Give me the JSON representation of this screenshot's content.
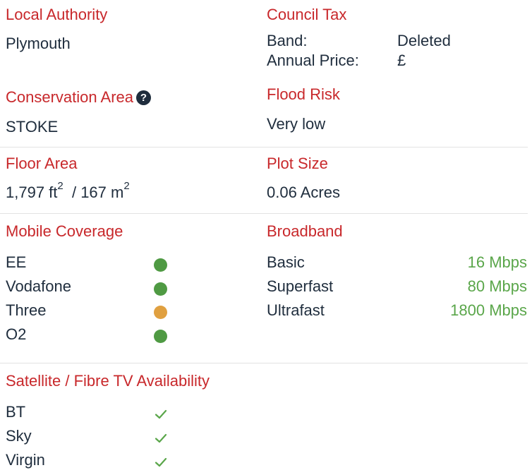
{
  "local_authority": {
    "heading": "Local Authority",
    "value": "Plymouth"
  },
  "council_tax": {
    "heading": "Council Tax",
    "band_label": "Band:",
    "band_value": "Deleted",
    "price_label": "Annual Price:",
    "price_value": "£"
  },
  "conservation_area": {
    "heading": "Conservation Area",
    "value": "STOKE",
    "help_icon": "question-circle-icon"
  },
  "flood_risk": {
    "heading": "Flood Risk",
    "value": "Very low"
  },
  "floor_area": {
    "heading": "Floor Area",
    "ft_value": "1,797 ft",
    "m_value": " / 167 m",
    "exponent": "2"
  },
  "plot_size": {
    "heading": "Plot Size",
    "value": "0.06 Acres"
  },
  "mobile_coverage": {
    "heading": "Mobile Coverage",
    "items": [
      {
        "name": "EE",
        "status_color": "#4f9a43"
      },
      {
        "name": "Vodafone",
        "status_color": "#4f9a43"
      },
      {
        "name": "Three",
        "status_color": "#e0a040"
      },
      {
        "name": "O2",
        "status_color": "#4f9a43"
      }
    ]
  },
  "broadband": {
    "heading": "Broadband",
    "items": [
      {
        "name": "Basic",
        "speed": "16 Mbps"
      },
      {
        "name": "Superfast",
        "speed": "80 Mbps"
      },
      {
        "name": "Ultrafast",
        "speed": "1800 Mbps"
      }
    ]
  },
  "tv_availability": {
    "heading": "Satellite / Fibre TV Availability",
    "items": [
      {
        "name": "BT",
        "available": true
      },
      {
        "name": "Sky",
        "available": true
      },
      {
        "name": "Virgin",
        "available": true
      }
    ]
  },
  "colors": {
    "heading": "#c8282b",
    "text": "#1f2d3d",
    "green": "#5aa64a",
    "divider": "#e3e3e3"
  }
}
